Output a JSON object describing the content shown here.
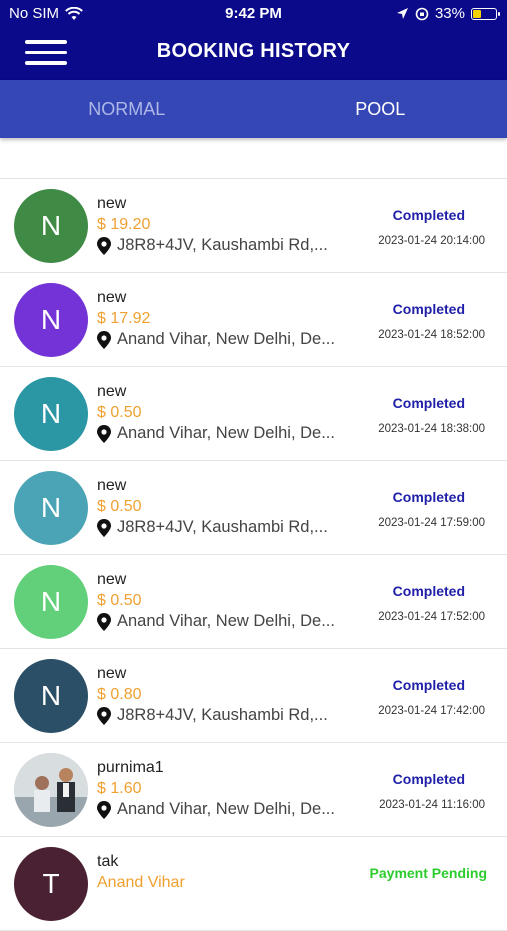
{
  "status_bar": {
    "carrier": "No SIM",
    "time": "9:42 PM",
    "battery": "33%"
  },
  "header": {
    "title": "BOOKING HISTORY"
  },
  "tabs": [
    {
      "label": "NORMAL",
      "active": false
    },
    {
      "label": "POOL",
      "active": true
    }
  ],
  "bookings": [
    {
      "avatar_letter": "N",
      "avatar_color": "#3f8a44",
      "name": "new",
      "fare": "$ 19.20",
      "address": "J8R8+4JV, Kaushambi Rd,...",
      "status": "Completed",
      "date": "2023-01-24 20:14:00"
    },
    {
      "avatar_letter": "N",
      "avatar_color": "#7433d6",
      "name": "new",
      "fare": "$ 17.92",
      "address": "Anand Vihar, New Delhi, De...",
      "status": "Completed",
      "date": "2023-01-24 18:52:00"
    },
    {
      "avatar_letter": "N",
      "avatar_color": "#2b97a5",
      "name": "new",
      "fare": "$ 0.50",
      "address": "Anand Vihar, New Delhi, De...",
      "status": "Completed",
      "date": "2023-01-24 18:38:00"
    },
    {
      "avatar_letter": "N",
      "avatar_color": "#4aa4b6",
      "name": "new",
      "fare": "$ 0.50",
      "address": "J8R8+4JV, Kaushambi Rd,...",
      "status": "Completed",
      "date": "2023-01-24 17:59:00"
    },
    {
      "avatar_letter": "N",
      "avatar_color": "#62d07a",
      "name": "new",
      "fare": "$ 0.50",
      "address": "Anand Vihar, New Delhi, De...",
      "status": "Completed",
      "date": "2023-01-24 17:52:00"
    },
    {
      "avatar_letter": "N",
      "avatar_color": "#2a4f66",
      "name": "new",
      "fare": "$ 0.80",
      "address": "J8R8+4JV, Kaushambi Rd,...",
      "status": "Completed",
      "date": "2023-01-24 17:42:00"
    },
    {
      "avatar_letter": "",
      "avatar_color": "photo",
      "name": "purnima1",
      "fare": "$ 1.60",
      "address": "Anand Vihar, New Delhi, De...",
      "status": "Completed",
      "date": "2023-01-24 11:16:00"
    },
    {
      "avatar_letter": "T",
      "avatar_color": "#4a2133",
      "name": "tak",
      "fare": "Anand Vihar",
      "address": "",
      "status": "Payment Pending",
      "date": ""
    }
  ]
}
